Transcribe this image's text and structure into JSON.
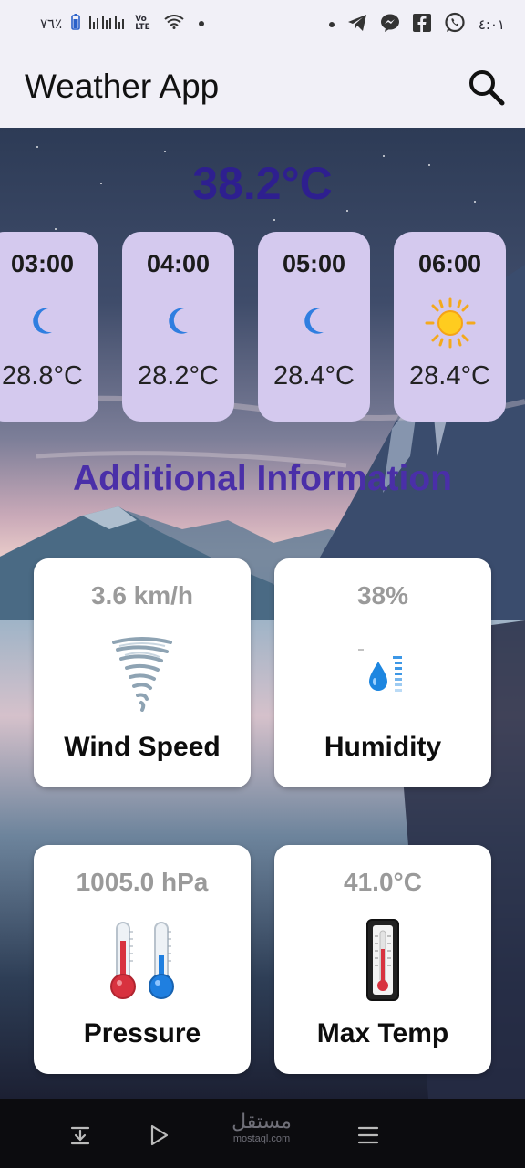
{
  "status_bar": {
    "battery_percent": "٧٦٪",
    "network_label": "Vo LTE",
    "time": "٤:٠١",
    "icons": [
      "battery-icon",
      "signal-bars-icon",
      "volte-icon",
      "wifi-icon",
      "dot-icon",
      "dot-icon",
      "telegram-icon",
      "messenger-icon",
      "facebook-icon",
      "whatsapp-icon"
    ]
  },
  "app_bar": {
    "title": "Weather App",
    "search_icon": "search-icon"
  },
  "current": {
    "temperature": "38.2°C"
  },
  "hourly": [
    {
      "time": "03:00",
      "icon": "moon-icon",
      "temp": "28.8°C"
    },
    {
      "time": "04:00",
      "icon": "moon-icon",
      "temp": "28.2°C"
    },
    {
      "time": "05:00",
      "icon": "moon-icon",
      "temp": "28.4°C"
    },
    {
      "time": "06:00",
      "icon": "sun-icon",
      "temp": "28.4°C"
    }
  ],
  "additional": {
    "title": "Additional Information",
    "items": [
      {
        "value": "3.6 km/h",
        "label": "Wind Speed",
        "icon": "tornado-icon"
      },
      {
        "value": "38%",
        "label": "Humidity",
        "icon": "humidity-drop-icon"
      },
      {
        "value": "1005.0 hPa",
        "label": "Pressure",
        "icon": "thermometers-icon"
      },
      {
        "value": "41.0°C",
        "label": "Max Temp",
        "icon": "thermometer-icon"
      }
    ]
  },
  "nav_bar": {
    "watermark_arabic": "مستقل",
    "watermark_latin": "mostaql.com",
    "buttons": [
      "download-icon",
      "play-icon",
      "menu-icon"
    ]
  },
  "colors": {
    "accent": "#4a2fa8",
    "temp_text": "#2e1f8f",
    "card_lavender": "#d4c9ee",
    "app_bar_bg": "#f1f0f7"
  }
}
